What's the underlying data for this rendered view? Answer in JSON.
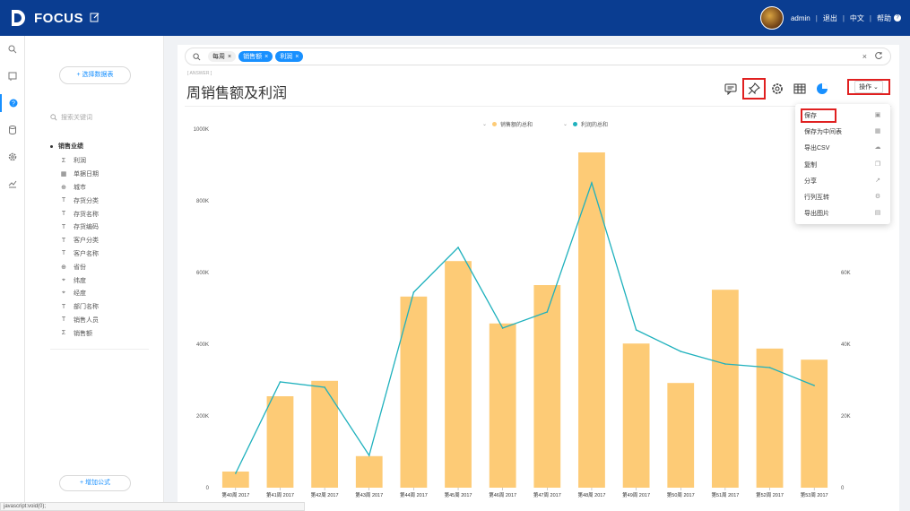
{
  "topbar": {
    "logo_text": "FOCUS",
    "user": "admin",
    "logout": "退出",
    "language": "中文",
    "help": "帮助",
    "sep": "|"
  },
  "panel": {
    "select_source": "+ 选择数据表",
    "search_placeholder": "搜索关键词",
    "root": "销售业绩",
    "fields": [
      {
        "label": "利润",
        "icon": "measure-icon"
      },
      {
        "label": "单据日期",
        "icon": "date-icon"
      },
      {
        "label": "城市",
        "icon": "geo-icon"
      },
      {
        "label": "存货分类",
        "icon": "text-icon"
      },
      {
        "label": "存货名称",
        "icon": "text-icon"
      },
      {
        "label": "存货编码",
        "icon": "text-icon"
      },
      {
        "label": "客户分类",
        "icon": "text-icon"
      },
      {
        "label": "客户名称",
        "icon": "text-icon"
      },
      {
        "label": "省份",
        "icon": "geo-icon"
      },
      {
        "label": "纬度",
        "icon": "coord-icon"
      },
      {
        "label": "经度",
        "icon": "coord-icon"
      },
      {
        "label": "部门名称",
        "icon": "text-icon"
      },
      {
        "label": "销售人员",
        "icon": "text-icon"
      },
      {
        "label": "销售额",
        "icon": "measure-icon"
      }
    ],
    "add_formula": "+ 增加公式"
  },
  "search": {
    "chips": [
      {
        "label": "每周",
        "style": "plain"
      },
      {
        "label": "销售额",
        "style": "blue"
      },
      {
        "label": "利润",
        "style": "blue"
      }
    ],
    "chip_close": "×",
    "clear": "×"
  },
  "main": {
    "answer_label": "[ ANSWER ]",
    "title": "周销售额及利润",
    "ops_label": "操作"
  },
  "menu": {
    "items": [
      {
        "label": "保存",
        "icon": "save-icon",
        "glyph": "▣"
      },
      {
        "label": "保存为中间表",
        "icon": "table-icon",
        "glyph": "▦"
      },
      {
        "label": "导出CSV",
        "icon": "cloud-download-icon",
        "glyph": "☁"
      },
      {
        "label": "复制",
        "icon": "copy-icon",
        "glyph": "❐"
      },
      {
        "label": "分享",
        "icon": "share-icon",
        "glyph": "↗"
      },
      {
        "label": "行列互转",
        "icon": "transpose-icon",
        "glyph": "⚙"
      },
      {
        "label": "导出图片",
        "icon": "image-icon",
        "glyph": "▤"
      }
    ]
  },
  "status_bar": "javascript:void(0);",
  "colors": {
    "bar": "#fdcb76",
    "line": "#1fb1bd",
    "header": "#0a3d91",
    "accent": "#1890ff",
    "highlight": "#e02020"
  },
  "chart_data": {
    "type": "bar",
    "categories": [
      "第40周 2017",
      "第41周 2017",
      "第42周 2017",
      "第43周 2017",
      "第44周 2017",
      "第45周 2017",
      "第46周 2017",
      "第47周 2017",
      "第48周 2017",
      "第49周 2017",
      "第50周 2017",
      "第51周 2017",
      "第52周 2017",
      "第53周 2017"
    ],
    "series": [
      {
        "name": "销售额的总和",
        "type": "bar",
        "axis": "left",
        "values": [
          45000,
          255000,
          298000,
          88000,
          533000,
          632000,
          458000,
          565000,
          935000,
          402000,
          292000,
          552000,
          388000,
          357000
        ]
      },
      {
        "name": "利润的总和",
        "type": "line",
        "axis": "right",
        "values": [
          4000,
          29500,
          28000,
          9000,
          54500,
          67000,
          44500,
          49000,
          85000,
          44000,
          38000,
          34500,
          33500,
          28500
        ]
      }
    ],
    "ylim_left": [
      0,
      1000000
    ],
    "yticks_left": [
      "0",
      "200K",
      "400K",
      "600K",
      "800K",
      "1000K"
    ],
    "ylim_right": [
      0,
      100000
    ],
    "yticks_right": [
      "0",
      "20K",
      "40K",
      "60K"
    ],
    "legend": "top-center"
  }
}
